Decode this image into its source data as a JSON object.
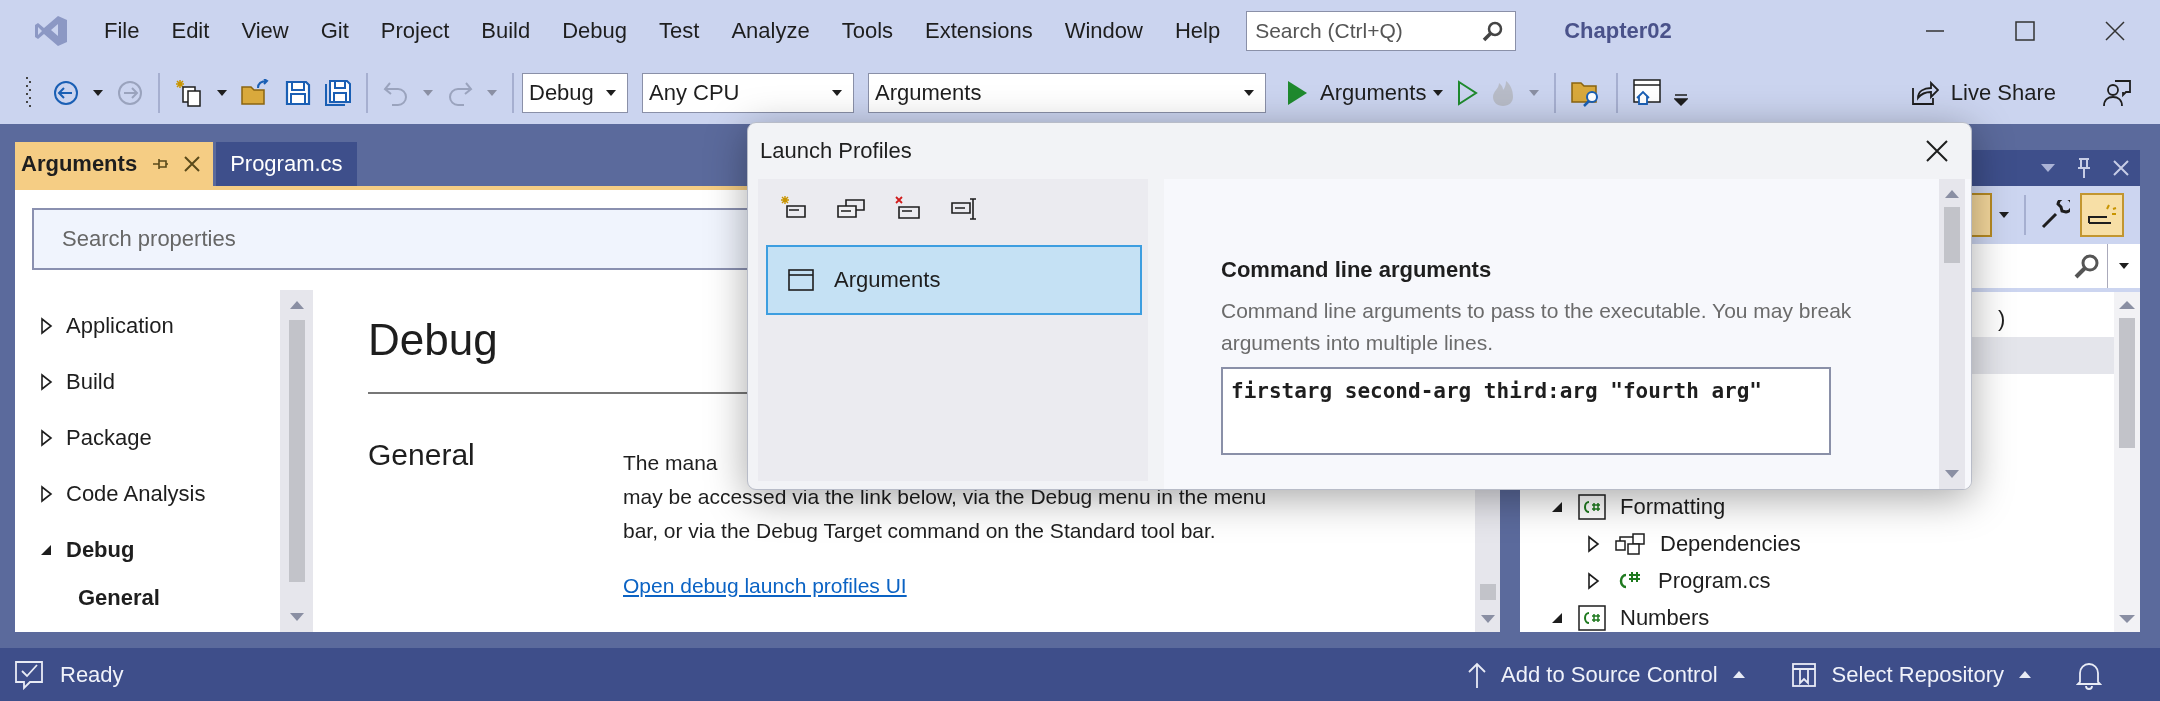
{
  "window": {
    "title": "Chapter02",
    "search": {
      "placeholder": "Search (Ctrl+Q)"
    }
  },
  "menu": [
    "File",
    "Edit",
    "View",
    "Git",
    "Project",
    "Build",
    "Debug",
    "Test",
    "Analyze",
    "Tools",
    "Extensions",
    "Window",
    "Help"
  ],
  "toolbar": {
    "back": {
      "disabled": false
    },
    "forward": {
      "disabled": true
    },
    "undo": {
      "disabled": true
    },
    "redo": {
      "disabled": true
    },
    "hot_reload": {
      "disabled": true
    },
    "configuration": "Debug",
    "platform": "Any CPU",
    "startup_item": "Arguments",
    "run_button": "Arguments",
    "live_share": "Live Share"
  },
  "document_tabs": [
    {
      "label": "Arguments",
      "selected": true
    },
    {
      "label": "Program.cs",
      "selected": false
    }
  ],
  "properties": {
    "search": {
      "placeholder": "Search properties"
    },
    "nav": [
      {
        "label": "Application",
        "expanded": false
      },
      {
        "label": "Build",
        "expanded": false
      },
      {
        "label": "Package",
        "expanded": false
      },
      {
        "label": "Code Analysis",
        "expanded": false
      },
      {
        "label": "Debug",
        "expanded": true,
        "children": [
          {
            "label": "General",
            "selected": true
          }
        ]
      }
    ],
    "page": {
      "title": "Debug",
      "section": "General",
      "description_lines": [
        "The mana",
        "may be accessed via the link below, via the Debug menu in the menu",
        "bar, or via the Debug Target command on the Standard tool bar."
      ],
      "link": "Open debug launch profiles UI"
    }
  },
  "solution_explorer": {
    "tree": [
      {
        "label": ")",
        "selected": false
      },
      {
        "selected": true
      },
      {
        "label": "Formatting",
        "kind": "project",
        "expanded": true,
        "selected": false,
        "children": [
          {
            "label": "Dependencies",
            "kind": "dependencies",
            "expanded": false,
            "selected": false
          },
          {
            "label": "Program.cs",
            "kind": "file",
            "expanded": false,
            "selected": false
          }
        ]
      },
      {
        "label": "Numbers",
        "kind": "project",
        "expanded": true,
        "selected": false
      }
    ]
  },
  "launch_profiles_dialog": {
    "title": "Launch Profiles",
    "profiles": [
      {
        "label": "Arguments",
        "selected": true
      }
    ],
    "setting": {
      "label": "Command line arguments",
      "description": "Command line arguments to pass to the executable. You may break arguments into multiple lines.",
      "value": "firstarg second-arg third:arg \"fourth arg\""
    }
  },
  "status_bar": {
    "status": "Ready",
    "items": [
      "Add to Source Control",
      "Select Repository"
    ]
  }
}
